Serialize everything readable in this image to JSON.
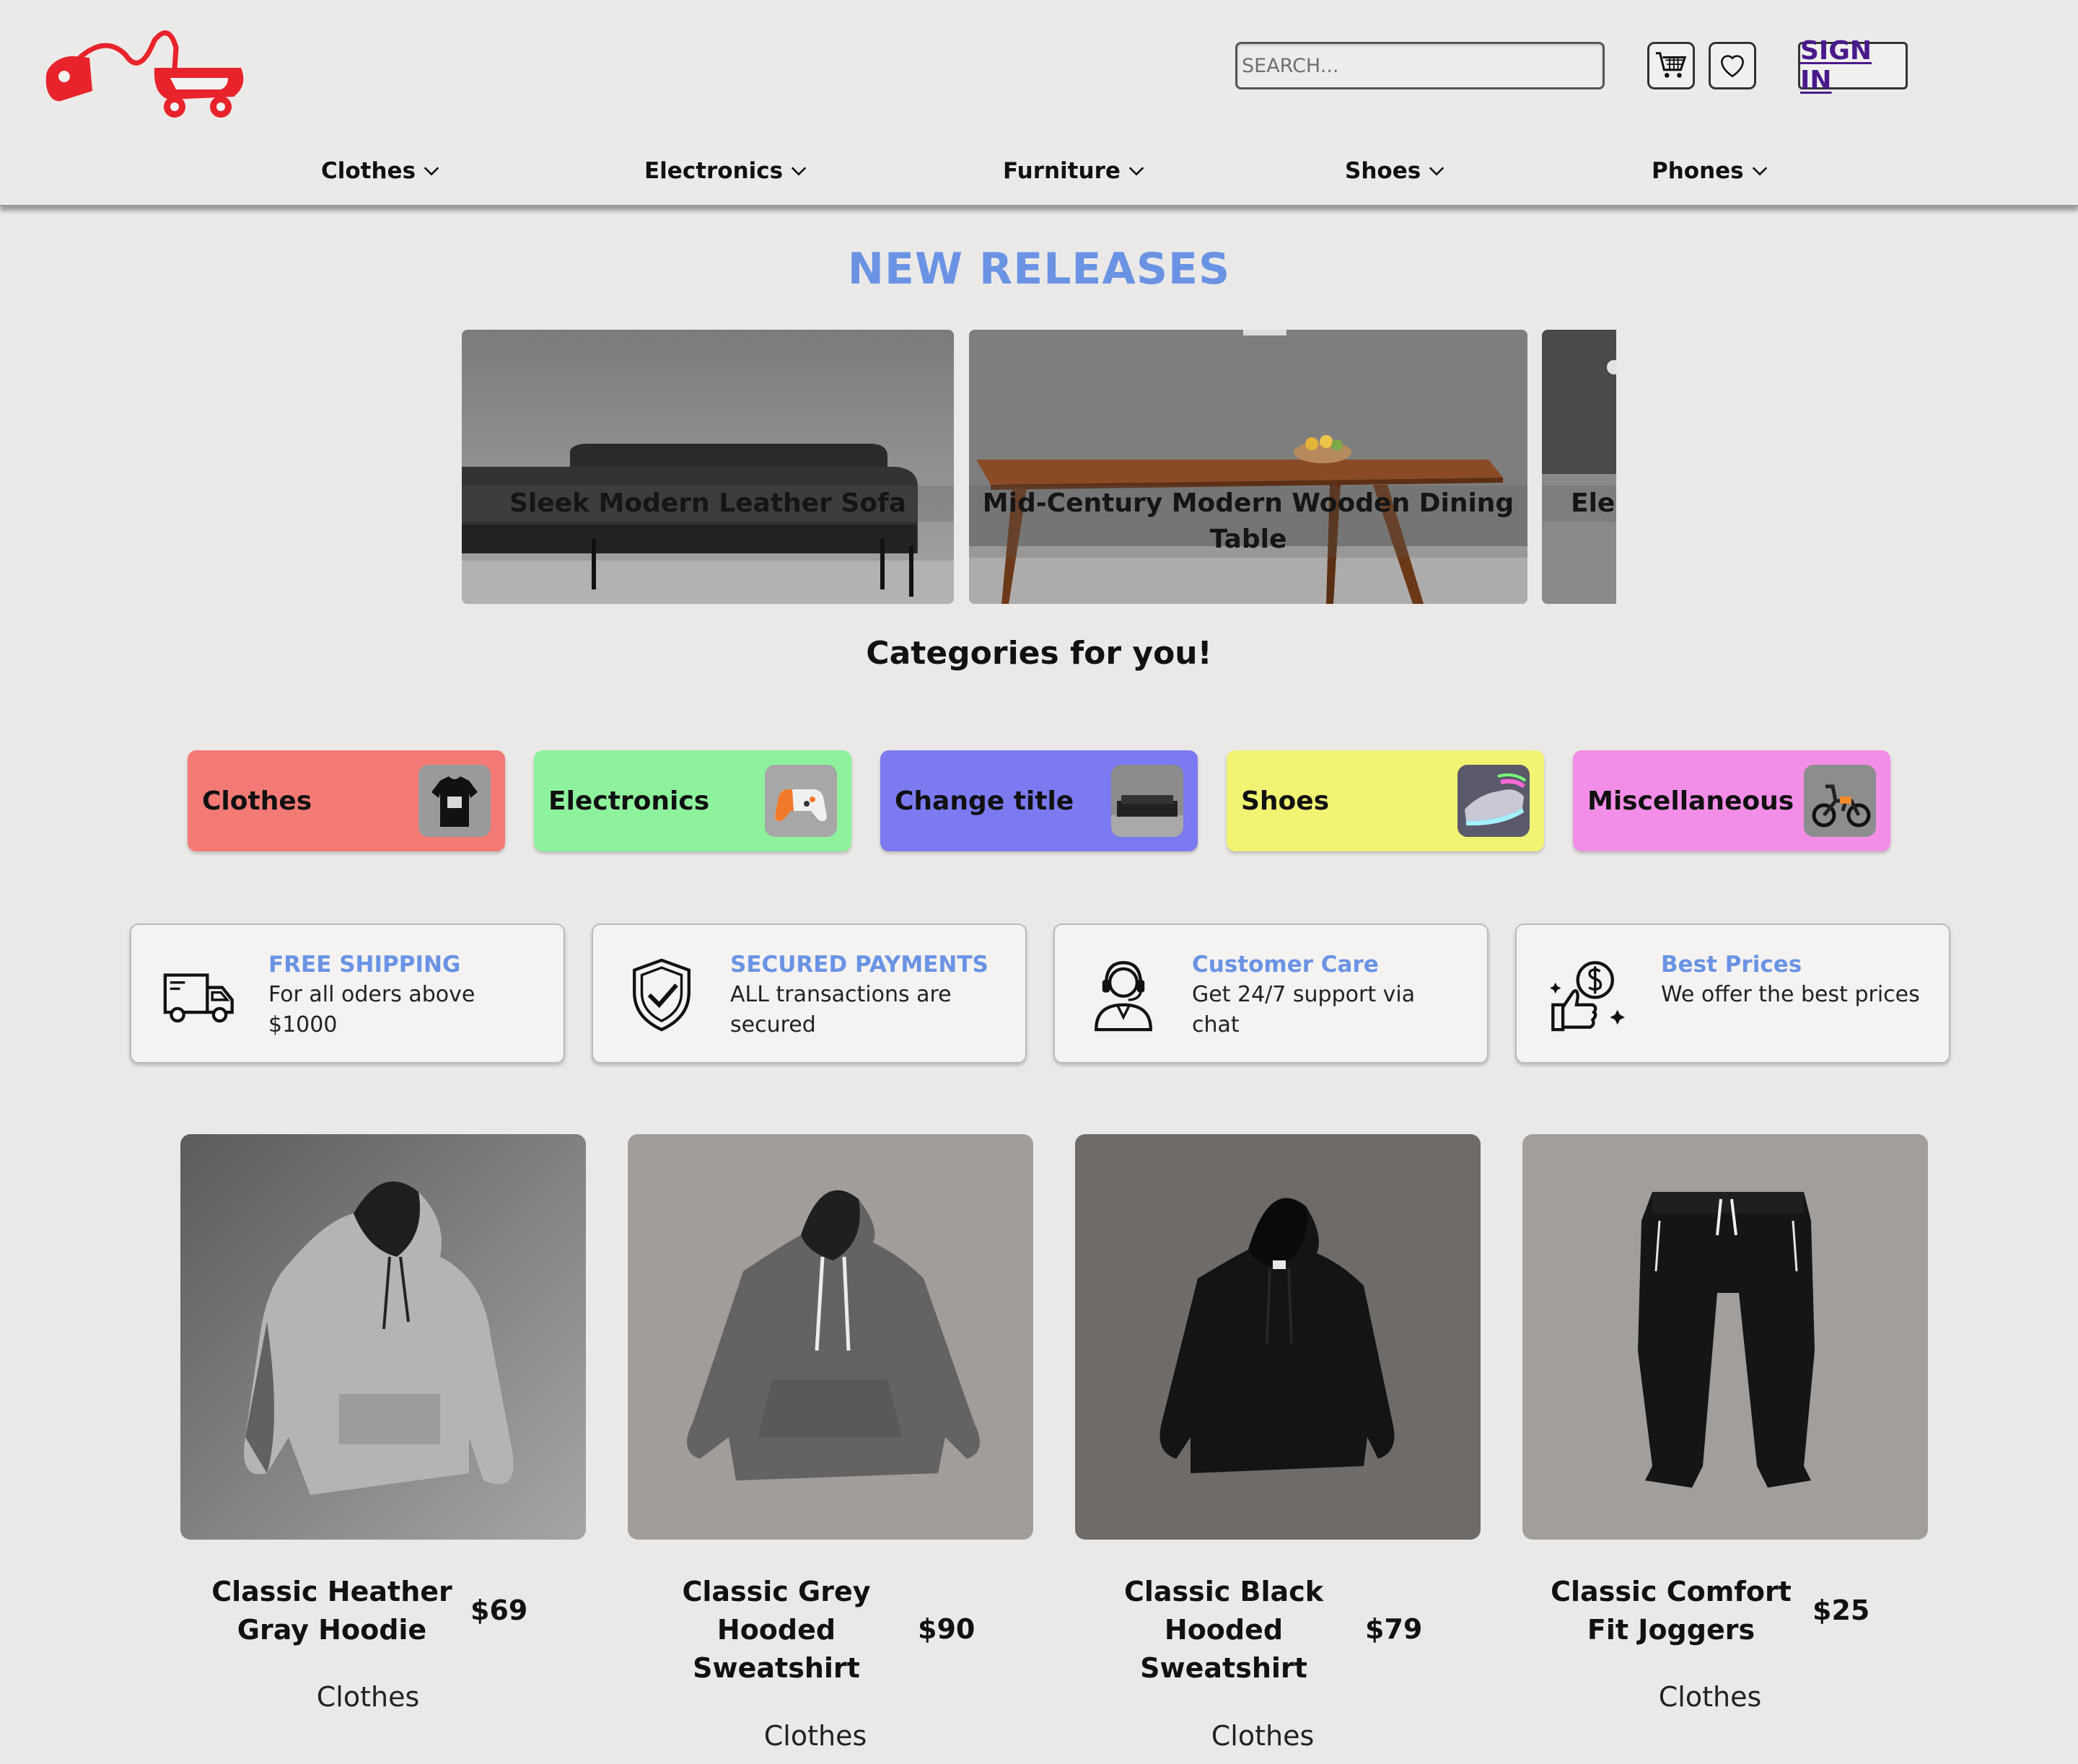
{
  "header": {
    "search_placeholder": "SEARCH...",
    "sign_in_label": "SIGN IN",
    "nav": [
      {
        "label": "Clothes"
      },
      {
        "label": "Electronics"
      },
      {
        "label": "Furniture"
      },
      {
        "label": "Shoes"
      },
      {
        "label": "Phones"
      }
    ]
  },
  "new_releases": {
    "title": "NEW RELEASES",
    "slides": [
      {
        "caption": "Sleek Modern Leather Sofa"
      },
      {
        "caption": "Mid-Century Modern Wooden Dining Table"
      },
      {
        "caption": "Eleg"
      }
    ]
  },
  "categories": {
    "title": "Categories for you!",
    "items": [
      {
        "label": "Clothes",
        "color": "#f47a75"
      },
      {
        "label": "Electronics",
        "color": "#8ef29c"
      },
      {
        "label": "Change title",
        "color": "#7b7af0"
      },
      {
        "label": "Shoes",
        "color": "#f1f373"
      },
      {
        "label": "Miscellaneous",
        "color": "#f28ee8"
      }
    ]
  },
  "features": [
    {
      "heading": "FREE SHIPPING",
      "text": "For all oders above $1000",
      "icon": "truck-icon"
    },
    {
      "heading": "SECURED PAYMENTS",
      "text": "ALL transactions are secured",
      "icon": "shield-check-icon"
    },
    {
      "heading": "Customer Care",
      "text": "Get 24/7 support via chat",
      "icon": "headset-agent-icon"
    },
    {
      "heading": "Best Prices",
      "text": "We offer the best prices",
      "icon": "thumbs-up-dollar-icon"
    }
  ],
  "products": [
    {
      "name": "Classic Heather Gray Hoodie",
      "price": "$69",
      "category": "Clothes"
    },
    {
      "name": "Classic Grey Hooded Sweatshirt",
      "price": "$90",
      "category": "Clothes"
    },
    {
      "name": "Classic Black Hooded Sweatshirt",
      "price": "$79",
      "category": "Clothes"
    },
    {
      "name": "Classic Comfort Fit Joggers",
      "price": "$25",
      "category": "Clothes"
    }
  ],
  "colors": {
    "accent": "#6a93e4",
    "sign_in": "#4a1a8c",
    "logo": "#e8232b"
  }
}
